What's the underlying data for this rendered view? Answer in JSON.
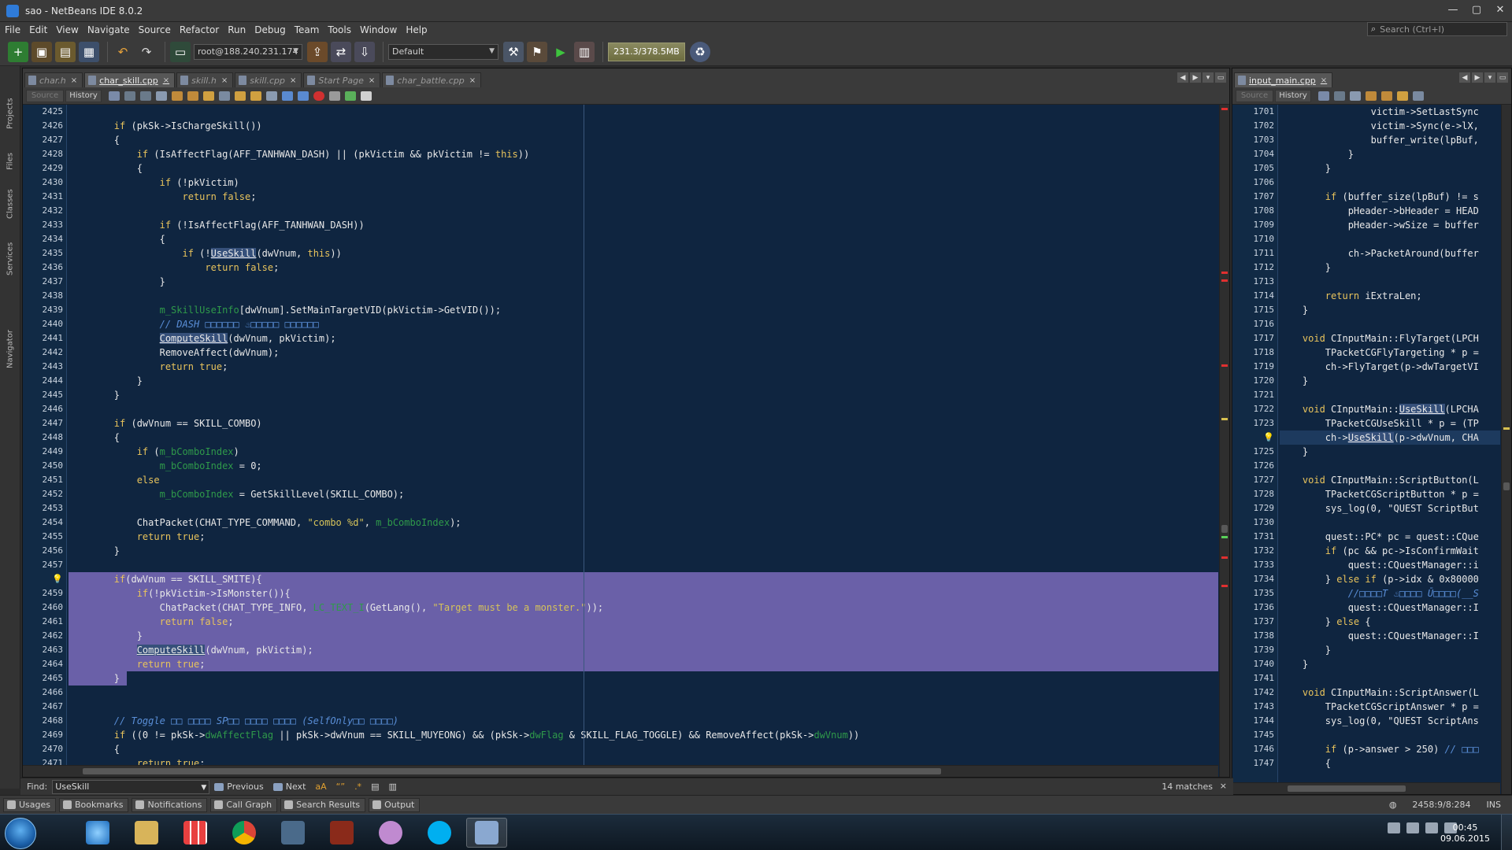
{
  "window": {
    "title": "sao - NetBeans IDE 8.0.2",
    "controls": [
      "—",
      "▢",
      "✕"
    ]
  },
  "menu": [
    "File",
    "Edit",
    "View",
    "Navigate",
    "Source",
    "Refactor",
    "Run",
    "Debug",
    "Team",
    "Tools",
    "Window",
    "Help"
  ],
  "search": {
    "placeholder": "Search (Ctrl+I)"
  },
  "toolbar": {
    "host": "root@188.240.231.174",
    "config": "Default",
    "memory": "231.3/378.5MB"
  },
  "left_sidebar": [
    "Projects",
    "Files",
    "Classes",
    "Services",
    "Navigator"
  ],
  "left_editor": {
    "tabs": [
      {
        "label": "char.h",
        "active": false
      },
      {
        "label": "char_skill.cpp",
        "active": true
      },
      {
        "label": "skill.h",
        "active": false
      },
      {
        "label": "skill.cpp",
        "active": false
      },
      {
        "label": "Start Page",
        "active": false
      },
      {
        "label": "char_battle.cpp",
        "active": false
      }
    ],
    "source_label": "Source",
    "history_label": "History",
    "lines": [
      {
        "n": "2425",
        "t": ""
      },
      {
        "n": "2426",
        "t": "\t\tif (pkSk->IsChargeSkill())"
      },
      {
        "n": "2427",
        "t": "\t\t{"
      },
      {
        "n": "2428",
        "t": "\t\t\tif (IsAffectFlag(AFF_TANHWAN_DASH) || (pkVictim && pkVictim != this))"
      },
      {
        "n": "2429",
        "t": "\t\t\t{"
      },
      {
        "n": "2430",
        "t": "\t\t\t\tif (!pkVictim)"
      },
      {
        "n": "2431",
        "t": "\t\t\t\t\treturn false;"
      },
      {
        "n": "2432",
        "t": ""
      },
      {
        "n": "2433",
        "t": "\t\t\t\tif (!IsAffectFlag(AFF_TANHWAN_DASH))"
      },
      {
        "n": "2434",
        "t": "\t\t\t\t{"
      },
      {
        "n": "2435",
        "t": "\t\t\t\t\tif (!UseSkill(dwVnum, this))"
      },
      {
        "n": "2436",
        "t": "\t\t\t\t\t\treturn false;"
      },
      {
        "n": "2437",
        "t": "\t\t\t\t}"
      },
      {
        "n": "2438",
        "t": ""
      },
      {
        "n": "2439",
        "t": "\t\t\t\tm_SkillUseInfo[dwVnum].SetMainTargetVID(pkVictim->GetVID());"
      },
      {
        "n": "2440",
        "t": "\t\t\t\t// DASH □□□□□□ ♨□□□□□ □□□□□□"
      },
      {
        "n": "2441",
        "t": "\t\t\t\tComputeSkill(dwVnum, pkVictim);"
      },
      {
        "n": "2442",
        "t": "\t\t\t\tRemoveAffect(dwVnum);"
      },
      {
        "n": "2443",
        "t": "\t\t\t\treturn true;"
      },
      {
        "n": "2444",
        "t": "\t\t\t}"
      },
      {
        "n": "2445",
        "t": "\t\t}"
      },
      {
        "n": "2446",
        "t": ""
      },
      {
        "n": "2447",
        "t": "\t\tif (dwVnum == SKILL_COMBO)"
      },
      {
        "n": "2448",
        "t": "\t\t{"
      },
      {
        "n": "2449",
        "t": "\t\t\tif (m_bComboIndex)"
      },
      {
        "n": "2450",
        "t": "\t\t\t\tm_bComboIndex = 0;"
      },
      {
        "n": "2451",
        "t": "\t\t\telse"
      },
      {
        "n": "2452",
        "t": "\t\t\t\tm_bComboIndex = GetSkillLevel(SKILL_COMBO);"
      },
      {
        "n": "2453",
        "t": ""
      },
      {
        "n": "2454",
        "t": "\t\t\tChatPacket(CHAT_TYPE_COMMAND, \"combo %d\", m_bComboIndex);"
      },
      {
        "n": "2455",
        "t": "\t\t\treturn true;"
      },
      {
        "n": "2456",
        "t": "\t\t}"
      },
      {
        "n": "2457",
        "t": ""
      },
      {
        "n": "",
        "t": "\t\tif(dwVnum == SKILL_SMITE){",
        "sel": true,
        "bulb": true
      },
      {
        "n": "2459",
        "t": "\t\t\tif(!pkVictim->IsMonster()){",
        "sel": true
      },
      {
        "n": "2460",
        "t": "\t\t\t\tChatPacket(CHAT_TYPE_INFO, LC_TEXT_I(GetLang(), \"Target must be a monster.\"));",
        "sel": true
      },
      {
        "n": "2461",
        "t": "\t\t\t\treturn false;",
        "sel": true
      },
      {
        "n": "2462",
        "t": "\t\t\t}",
        "sel": true
      },
      {
        "n": "2463",
        "t": "\t\t\tComputeSkill(dwVnum, pkVictim);",
        "sel": true
      },
      {
        "n": "2464",
        "t": "\t\t\treturn true;",
        "sel": true
      },
      {
        "n": "2465",
        "t": "\t\t}",
        "sel": true,
        "partial": true
      },
      {
        "n": "2466",
        "t": ""
      },
      {
        "n": "2467",
        "t": ""
      },
      {
        "n": "2468",
        "t": "\t\t// Toggle □□ □□□□ SP□□ □□□□ □□□□ (SelfOnly□□ □□□□)"
      },
      {
        "n": "2469",
        "t": "\t\tif ((0 != pkSk->dwAffectFlag || pkSk->dwVnum == SKILL_MUYEONG) && (pkSk->dwFlag & SKILL_FLAG_TOGGLE) && RemoveAffect(pkSk->dwVnum))"
      },
      {
        "n": "2470",
        "t": "\t\t{"
      },
      {
        "n": "2471",
        "t": "\t\t\treturn true;"
      }
    ]
  },
  "right_editor": {
    "tabs": [
      {
        "label": "input_main.cpp",
        "active": true
      }
    ],
    "source_label": "Source",
    "history_label": "History",
    "lines": [
      {
        "n": "1701",
        "t": "\t\t\t\tvictim->SetLastSync"
      },
      {
        "n": "1702",
        "t": "\t\t\t\tvictim->Sync(e->lX,"
      },
      {
        "n": "1703",
        "t": "\t\t\t\tbuffer_write(lpBuf,"
      },
      {
        "n": "1704",
        "t": "\t\t\t}"
      },
      {
        "n": "1705",
        "t": "\t\t}"
      },
      {
        "n": "1706",
        "t": ""
      },
      {
        "n": "1707",
        "t": "\t\tif (buffer_size(lpBuf) != s"
      },
      {
        "n": "1708",
        "t": "\t\t\tpHeader->bHeader = HEAD"
      },
      {
        "n": "1709",
        "t": "\t\t\tpHeader->wSize = buffer"
      },
      {
        "n": "1710",
        "t": ""
      },
      {
        "n": "1711",
        "t": "\t\t\tch->PacketAround(buffer"
      },
      {
        "n": "1712",
        "t": "\t\t}"
      },
      {
        "n": "1713",
        "t": ""
      },
      {
        "n": "1714",
        "t": "\t\treturn iExtraLen;"
      },
      {
        "n": "1715",
        "t": "\t}"
      },
      {
        "n": "1716",
        "t": ""
      },
      {
        "n": "1717",
        "t": "\tvoid CInputMain::FlyTarget(LPCH"
      },
      {
        "n": "1718",
        "t": "\t\tTPacketCGFlyTargeting * p ="
      },
      {
        "n": "1719",
        "t": "\t\tch->FlyTarget(p->dwTargetVI"
      },
      {
        "n": "1720",
        "t": "\t}"
      },
      {
        "n": "1721",
        "t": ""
      },
      {
        "n": "1722",
        "t": "\tvoid CInputMain::UseSkill(LPCHA"
      },
      {
        "n": "1723",
        "t": "\t\tTPacketCGUseSkill * p = (TP"
      },
      {
        "n": "",
        "t": "\t\tch->UseSkill(p->dwVnum, CHA",
        "cur": true,
        "bulb": true
      },
      {
        "n": "1725",
        "t": "\t}"
      },
      {
        "n": "1726",
        "t": ""
      },
      {
        "n": "1727",
        "t": "\tvoid CInputMain::ScriptButton(L"
      },
      {
        "n": "1728",
        "t": "\t\tTPacketCGScriptButton * p ="
      },
      {
        "n": "1729",
        "t": "\t\tsys_log(0, \"QUEST ScriptBut"
      },
      {
        "n": "1730",
        "t": ""
      },
      {
        "n": "1731",
        "t": "\t\tquest::PC* pc = quest::CQue"
      },
      {
        "n": "1732",
        "t": "\t\tif (pc && pc->IsConfirmWait"
      },
      {
        "n": "1733",
        "t": "\t\t\tquest::CQuestManager::i"
      },
      {
        "n": "1734",
        "t": "\t\t} else if (p->idx & 0x80000"
      },
      {
        "n": "1735",
        "t": "\t\t\t//□□□□T ♨□□□□ Ū□□□□(__S"
      },
      {
        "n": "1736",
        "t": "\t\t\tquest::CQuestManager::I"
      },
      {
        "n": "1737",
        "t": "\t\t} else {"
      },
      {
        "n": "1738",
        "t": "\t\t\tquest::CQuestManager::I"
      },
      {
        "n": "1739",
        "t": "\t\t}"
      },
      {
        "n": "1740",
        "t": "\t}"
      },
      {
        "n": "1741",
        "t": ""
      },
      {
        "n": "1742",
        "t": "\tvoid CInputMain::ScriptAnswer(L"
      },
      {
        "n": "1743",
        "t": "\t\tTPacketCGScriptAnswer * p ="
      },
      {
        "n": "1744",
        "t": "\t\tsys_log(0, \"QUEST ScriptAns"
      },
      {
        "n": "1745",
        "t": ""
      },
      {
        "n": "1746",
        "t": "\t\tif (p->answer > 250) // □□□"
      },
      {
        "n": "1747",
        "t": "\t\t{"
      }
    ]
  },
  "find": {
    "label": "Find:",
    "value": "UseSkill",
    "previous": "Previous",
    "next": "Next",
    "matches": "14 matches",
    "close": "×"
  },
  "output_tabs": [
    "Usages",
    "Bookmarks",
    "Notifications",
    "Call Graph",
    "Search Results",
    "Output"
  ],
  "status": {
    "position": "2458:9/8:284",
    "mode": "INS"
  },
  "clock": {
    "time": "00:45",
    "date": "09.06.2015"
  },
  "colors": {
    "editor_bg": "#0f2540",
    "selection": "#6a60a8",
    "keyword": "#e8c35c",
    "comment": "#5a8fd8",
    "field": "#2f9a4a"
  },
  "taskbar_apps": [
    "ie-icon",
    "explorer-icon",
    "grid-app-icon",
    "chrome-icon",
    "network-app-icon",
    "game-icon",
    "cat-app-icon",
    "skype-icon",
    "netbeans-icon"
  ]
}
